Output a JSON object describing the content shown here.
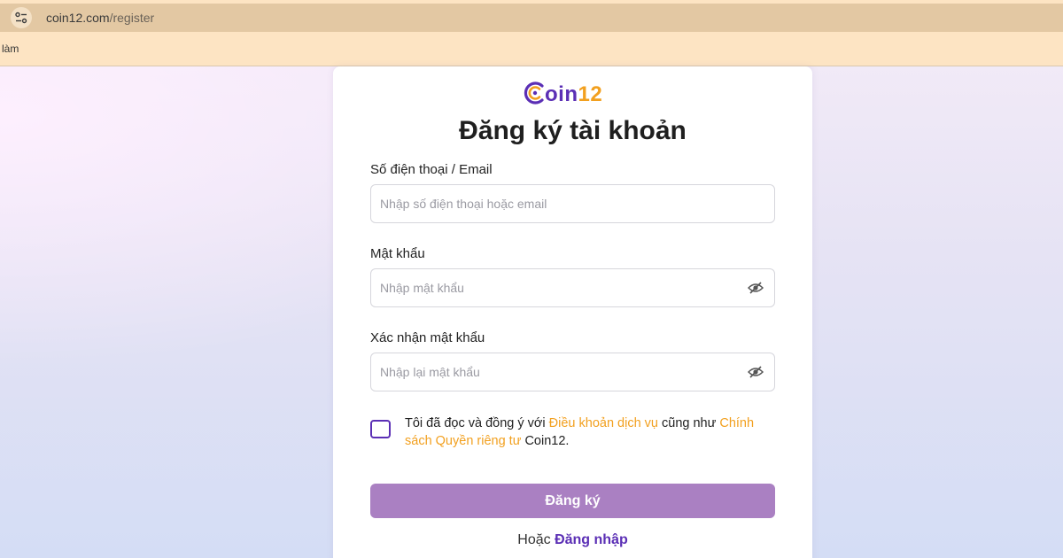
{
  "browser": {
    "url_domain": "coin12.com",
    "url_path": "/register",
    "bookmark_label": "làm",
    "site_info_icon": "tune-icon"
  },
  "brand": {
    "logo_letter": "oin",
    "logo_number": "12",
    "logo_icon": "coin-c-icon",
    "primary_color": "#5b2fb5",
    "accent_color": "#f2a01f"
  },
  "form": {
    "title": "Đăng ký tài khoản",
    "identifier_label": "Số điện thoại / Email",
    "identifier_placeholder": "Nhập số điện thoại hoặc email",
    "identifier_value": "",
    "password_label": "Mật khẩu",
    "password_placeholder": "Nhập mật khẩu",
    "password_value": "",
    "confirm_label": "Xác nhận mật khẩu",
    "confirm_placeholder": "Nhập lại mật khẩu",
    "confirm_value": "",
    "visibility_icon": "eye-slash-icon",
    "terms_checked": false,
    "terms_prefix": "Tôi đã đọc và đồng ý với ",
    "terms_link": "Điều khoản dịch vụ",
    "terms_middle": " cũng như ",
    "privacy_link": "Chính sách Quyền riêng tư",
    "terms_suffix": " Coin12.",
    "submit_label": "Đăng ký",
    "submit_color": "#aa80c2",
    "alt_prefix": "Hoặc ",
    "alt_link": "Đăng nhập"
  }
}
